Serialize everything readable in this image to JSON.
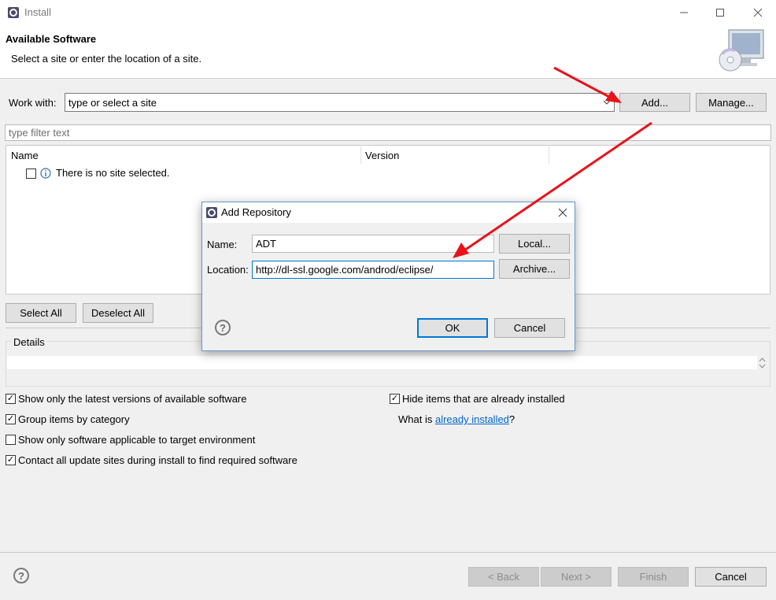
{
  "window": {
    "title": "Install"
  },
  "banner": {
    "title": "Available Software",
    "description": "Select a site or enter the location of a site."
  },
  "work_with": {
    "label": "Work with:",
    "placeholder": "type or select a site",
    "add_label": "Add...",
    "manage_label": "Manage..."
  },
  "filter": {
    "placeholder": "type filter text"
  },
  "table": {
    "columns": [
      "Name",
      "Version"
    ],
    "empty_message": "There is no site selected."
  },
  "selection_buttons": {
    "select_all": "Select All",
    "deselect_all": "Deselect All"
  },
  "details": {
    "label": "Details"
  },
  "options": {
    "latest_versions": {
      "label": "Show only the latest versions of available software",
      "checked": true
    },
    "group_by_category": {
      "label": "Group items by category",
      "checked": true
    },
    "target_env": {
      "label": "Show only software applicable to target environment",
      "checked": false
    },
    "contact_sites": {
      "label": "Contact all update sites during install to find required software",
      "checked": true
    },
    "hide_installed": {
      "label": "Hide items that are already installed",
      "checked": true
    },
    "what_is_prefix": "What is ",
    "already_installed_link": "already installed",
    "what_is_suffix": "?"
  },
  "footer": {
    "back": "< Back",
    "next": "Next >",
    "finish": "Finish",
    "cancel": "Cancel"
  },
  "dialog": {
    "title": "Add Repository",
    "name_label": "Name:",
    "name_value": "ADT",
    "location_label": "Location:",
    "location_value": "http://dl-ssl.google.com/androd/eclipse/",
    "local_button": "Local...",
    "archive_button": "Archive...",
    "ok_button": "OK",
    "cancel_button": "Cancel"
  },
  "help_glyph": "?",
  "colors": {
    "arrow": "#e8131b",
    "link": "#0066cc",
    "accent": "#0078d7"
  }
}
